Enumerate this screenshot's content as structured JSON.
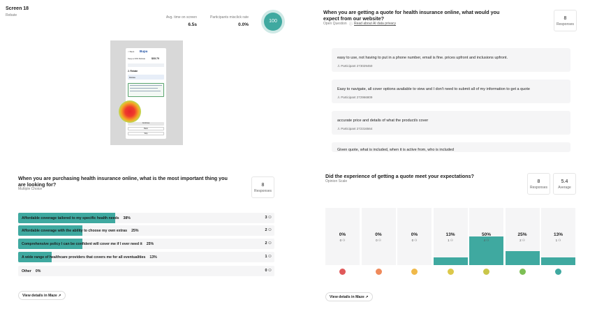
{
  "screen": {
    "title": "Screen 18",
    "subtitle": "Rebate",
    "avg_time_label": "Avg. time on screen",
    "avg_time_value": "6.5s",
    "misclick_label": "Participants misclick rate",
    "misclick_value": "0.0%",
    "score": "100",
    "thumb": {
      "header": "Bupa",
      "back": "< Back",
      "text1": "Keep a 33% Rebate",
      "amount": "$33.70",
      "step": "2. Rebate",
      "option": "Rebate",
      "btn1": "Continue",
      "btn2": "Back",
      "btn3": "Skip"
    }
  },
  "q1": {
    "title": "When you are getting a quote for health insurance online, what would you expect from our website?",
    "type": "Open Question",
    "link": "Read about AI data privacy",
    "count": "8",
    "count_label": "Responses",
    "responses": [
      {
        "text": "easy to use, not having to put in a phone number, email is fine. prices upfront and inclusions upfront.",
        "participant": "Participant 273029450"
      },
      {
        "text": "Easy to navigate, all cover options available to view and I don't need to submit all of my information to get a quote",
        "participant": "Participant 272966809"
      },
      {
        "text": "accurate price and details of what the product/s cover",
        "participant": "Participant 272316564"
      },
      {
        "text": "Given quote, what is included, when it is active from, who is included",
        "participant": ""
      }
    ]
  },
  "q2": {
    "title": "When you are purchasing health insurance online, what is the most important thing you are looking for?",
    "type": "Multiple Choice",
    "count": "8",
    "count_label": "Responses",
    "options": [
      {
        "label": "Affordable coverage tailored to my specific health needs",
        "pct_text": "38%",
        "count": "3",
        "fraction": 0.38
      },
      {
        "label": "Affordable coverage with the ability to choose my own extras",
        "pct_text": "25%",
        "count": "2",
        "fraction": 0.25
      },
      {
        "label": "Comprehensive policy I can be confident will cover me if I ever need it",
        "pct_text": "25%",
        "count": "2",
        "fraction": 0.25
      },
      {
        "label": "A wide range of healthcare providers that covers me for all eventualities",
        "pct_text": "13%",
        "count": "1",
        "fraction": 0.13
      },
      {
        "label": "Other",
        "pct_text": "0%",
        "count": "0",
        "fraction": 0
      }
    ],
    "button": "View details in Maze"
  },
  "q3": {
    "title": "Did the experience of getting a quote meet your expectations?",
    "type": "Opinion Scale",
    "count": "8",
    "count_label": "Responses",
    "avg": "5.4",
    "avg_label": "Average",
    "columns": [
      {
        "pct": "0%",
        "count": "0",
        "fraction": 0,
        "face_color": "#e0595a"
      },
      {
        "pct": "0%",
        "count": "0",
        "fraction": 0,
        "face_color": "#ef8a5b"
      },
      {
        "pct": "0%",
        "count": "0",
        "fraction": 0,
        "face_color": "#f0b94a"
      },
      {
        "pct": "13%",
        "count": "1",
        "fraction": 0.13,
        "face_color": "#dcc84a"
      },
      {
        "pct": "50%",
        "count": "4",
        "fraction": 0.5,
        "face_color": "#c9c64a"
      },
      {
        "pct": "25%",
        "count": "2",
        "fraction": 0.25,
        "face_color": "#7dbf55"
      },
      {
        "pct": "13%",
        "count": "1",
        "fraction": 0.13,
        "face_color": "#3fa9a0"
      }
    ],
    "button": "View details in Maze"
  },
  "accent": "#3fa9a0"
}
